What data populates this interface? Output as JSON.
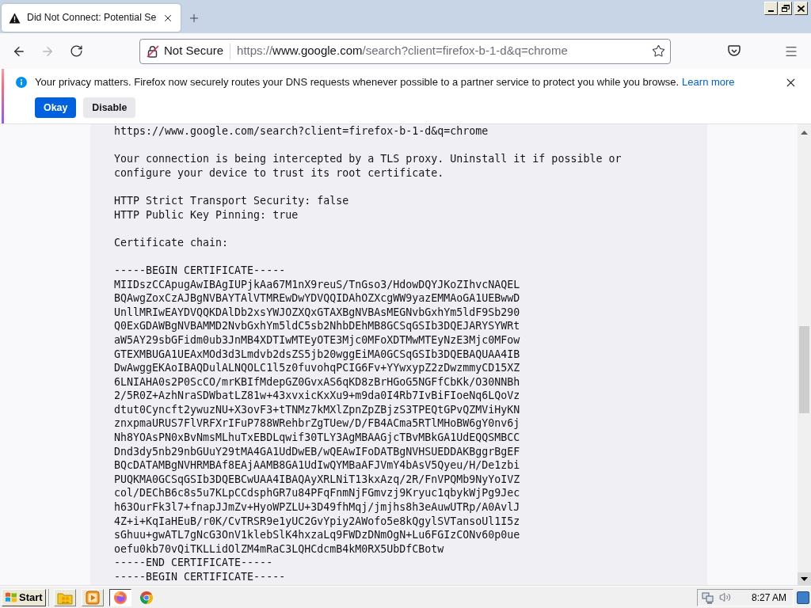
{
  "tabs": [
    {
      "kind": "warning",
      "title": "Did Not Connect: Potential Se",
      "selected": true
    }
  ],
  "toolbar": {
    "nav_buttons": [
      {
        "kind": "back",
        "disabled": false
      },
      {
        "kind": "forward",
        "disabled": true
      },
      {
        "kind": "reload",
        "disabled": false
      }
    ],
    "security_label": "Not Secure",
    "url_parts": [
      {
        "text": "https://",
        "emphasis": false
      },
      {
        "text": "www.google.com",
        "emphasis": true
      },
      {
        "text": "/search?client=firefox-b-1-d&q=chrome",
        "emphasis": false
      }
    ]
  },
  "notification": {
    "message": "Your privacy matters. Firefox now securely routes your DNS requests whenever possible to a partner service to protect you while you browse.",
    "link": "Learn more",
    "buttons": [
      {
        "label": "Okay",
        "primary": true
      },
      {
        "label": "Disable",
        "primary": false
      }
    ]
  },
  "details": {
    "url_line": "https://www.google.com/search?client=firefox-b-1-d&q=chrome",
    "message_lines": [
      "Your connection is being intercepted by a TLS proxy. Uninstall it if possible or",
      "configure your device to trust its root certificate."
    ],
    "properties": [
      "HTTP Strict Transport Security: false",
      "HTTP Public Key Pinning: true"
    ],
    "chain_label": "Certificate chain:",
    "certificates": [
      {
        "begin": "-----BEGIN CERTIFICATE-----",
        "body": [
          "MIIDszCCApugAwIBAgIUPjkAa67M1nX9reuS/TnGso3/HdowDQYJKoZIhvcNAQEL",
          "BQAwgZoxCzAJBgNVBAYTAlVTMREwDwYDVQQIDAhOZXcgWW9yazEMMAoGA1UEBwwD",
          "UnllMRIwEAYDVQQKDAlDb2xsYWJOZXQxGTAXBgNVBAsMEGNvbGxhYm5ldF9Sb290",
          "Q0ExGDAWBgNVBAMMD2NvbGxhYm5ldC5sb2NhbDEhMB8GCSqGSIb3DQEJARYSYWRt",
          "aW5AY29sbGFidm0ub3JnMB4XDTIwMTEyOTE3Mjc0MFoXDTMwMTEyNzE3Mjc0MFow",
          "GTEXMBUGA1UEAxMOd3d3Lmdvb2dsZS5jb20wggEiMA0GCSqGSIb3DQEBAQUAA4IB",
          "DwAwggEKAoIBAQDulALNQOLC1l5z0fuvohqPCIG6Fv+YYwxypZ2zDwzmmyCD15XZ",
          "6LNIAHA0s2P0ScCO/mrKBIfMdepGZ0GvxAS6qKD8zBrHGoG5NGFfCbKk/O30NNBh",
          "2/5R0Z+AzhNraSDWbatLZ81w+43xvxicKxXu9+m9da0I4Rb7IvBiFIoeNq6LQoVz",
          "dtut0Cyncft2ywuzNU+X3ovF3+tTNMz7kMXlZpnZpZBjzS3TPEQtGPvQZMViHyKN",
          "znxpmaURUS7FlVRFXrIFuP788WRehbrZgTUew/D/FB4ACma5RTlMHoBW6gY0nv6j",
          "Nh8YOAsPN0xBvNmsMLhuTxEBDLqwif30TLY3AgMBAAGjcTBvMBkGA1UdEQQSMBCC",
          "Dnd3dy5nb29nbGUuY29tMA4GA1UdDwEB/wQEAwIFoDATBgNVHSUEDDAKBggrBgEF",
          "BQcDATAMBgNVHRMBAf8EAjAAMB8GA1UdIwQYMBaAFJVmY4bAsV5Qyeu/H/De1zbi",
          "PUQKMA0GCSqGSIb3DQEBCwUAA4IBAQAyXRLNiT13kxAzq/2R/FnVPQMb9NyYoIVZ",
          "col/DEChB6c8s5u7KLpCCdsphGR7u84PFqFnmNjFGmvzj9Kryuc1qbykWjPg9Jec",
          "h63OurFk3l7+fnapJJmZv+HyoWPZLU+3D49fhMqj/jmjhs8h3eAuwUTRp/A0AvlJ",
          "4Z+i+KqIaHEuB/r0K/CvTRSR9e1yUC2GvYpiy2AWofo5e8kQgylSVTansoUl1I5z",
          "sGhuu+gwATL7gNcG3OnV1klebSlK4hxzaLq9FWDzDNmOgN+Lu6FGIzCONv60p0ue",
          "oefu0kb70vQiTKLLidOlZM4mRaC3LQHCdcmB4kM0RX5UbDfCBotw"
        ],
        "end": "-----END CERTIFICATE-----"
      },
      {
        "begin": "-----BEGIN CERTIFICATE-----"
      }
    ]
  },
  "taskbar": {
    "start_label": "Start",
    "apps": [
      {
        "kind": "folder",
        "open": true,
        "selected": false
      },
      {
        "kind": "media",
        "open": true,
        "selected": false
      },
      {
        "kind": "firefox",
        "open": true,
        "selected": true
      },
      {
        "kind": "chrome",
        "open": false,
        "selected": false
      }
    ],
    "clock": "8:27 AM"
  }
}
